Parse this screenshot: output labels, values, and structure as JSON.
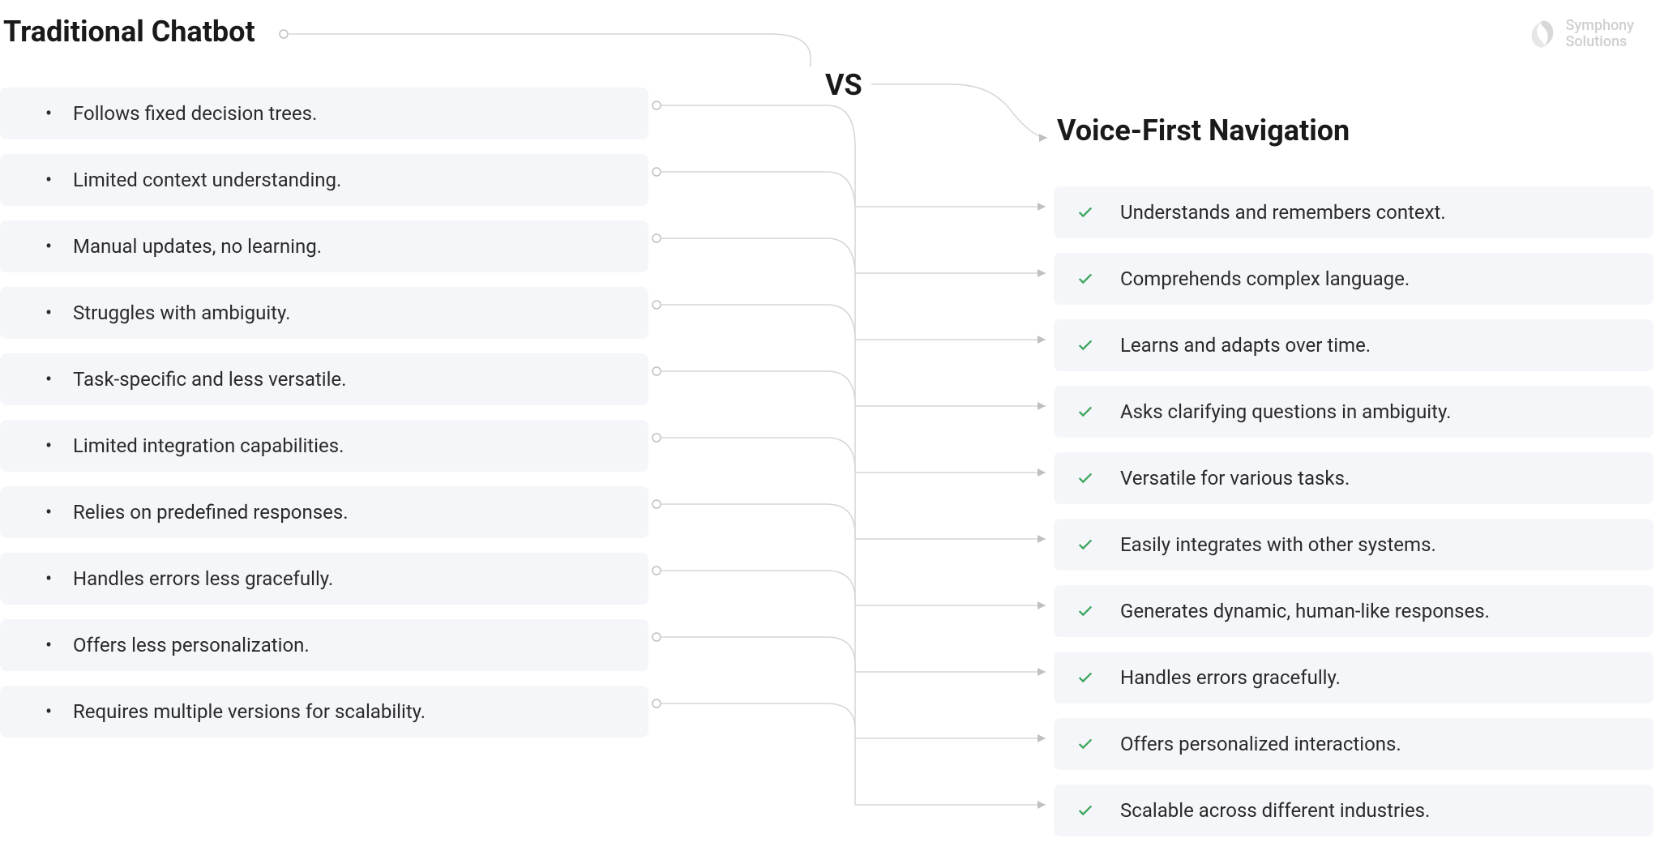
{
  "logo": {
    "line1": "Symphony",
    "line2": "Solutions"
  },
  "vs_label": "VS",
  "left": {
    "title": "Traditional Chatbot",
    "items": [
      "Follows fixed decision trees.",
      "Limited context understanding.",
      "Manual updates, no learning.",
      "Struggles with ambiguity.",
      "Task-specific and less versatile.",
      "Limited integration capabilities.",
      "Relies on predefined responses.",
      "Handles errors less gracefully.",
      "Offers less personalization.",
      "Requires multiple versions for scalability."
    ]
  },
  "right": {
    "title": "Voice-First Navigation",
    "items": [
      "Understands and remembers context.",
      "Comprehends complex language.",
      "Learns and adapts over time.",
      "Asks clarifying questions in ambiguity.",
      "Versatile for various tasks.",
      "Easily integrates with other systems.",
      "Generates dynamic, human-like responses.",
      "Handles errors gracefully.",
      "Offers personalized interactions.",
      "Scalable across different industries."
    ]
  }
}
